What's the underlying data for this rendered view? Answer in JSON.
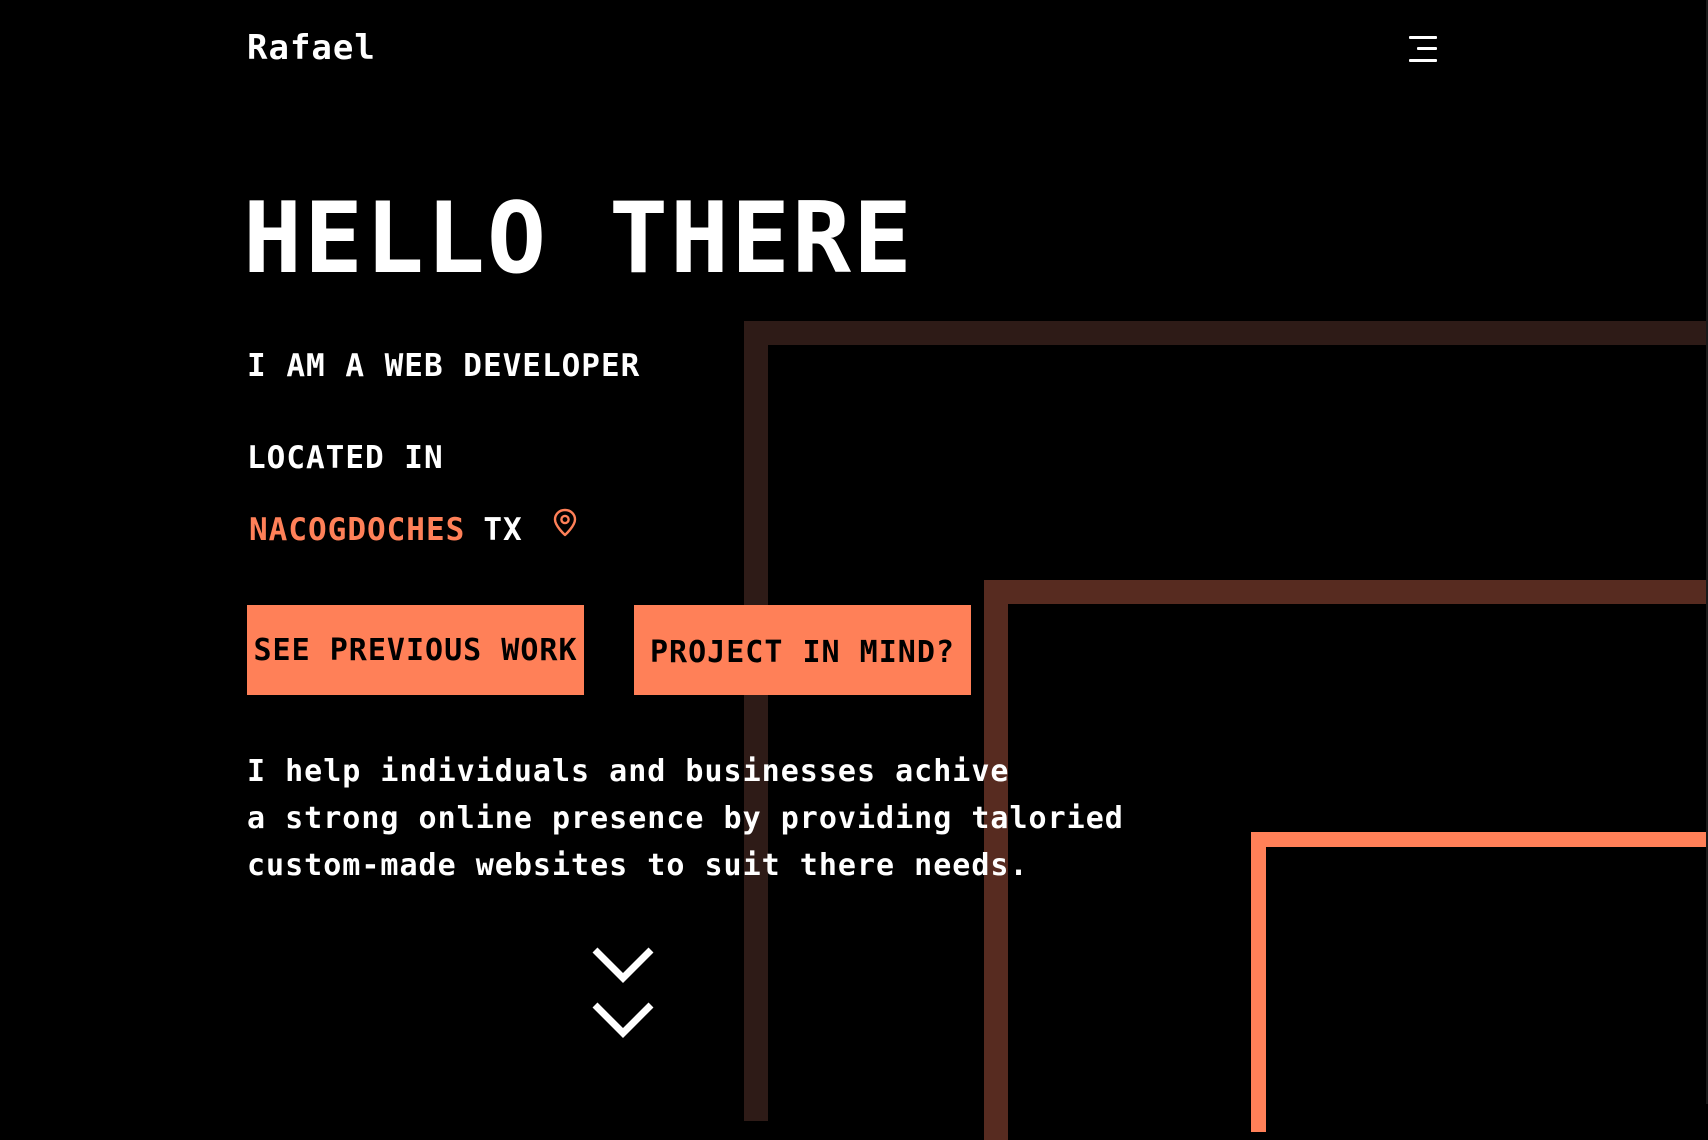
{
  "header": {
    "logo": "Rafael",
    "menu_icon": "hamburger-menu-icon"
  },
  "hero": {
    "title": "HELLO THERE",
    "role": "I AM A WEB DEVELOPER",
    "located_label": "LOCATED IN",
    "city": "NACOGDOCHES",
    "state": "TX",
    "location_icon": "map-pin-icon"
  },
  "buttons": {
    "previous_work": "SEE PREVIOUS WORK",
    "project": "PROJECT IN MIND?"
  },
  "description": {
    "lines": [
      "I help individuals and businesses achive",
      "a strong online presence by providing taloried",
      "custom-made websites to suit there needs."
    ]
  },
  "scroll": {
    "icon": "double-chevron-down-icon"
  },
  "colors": {
    "background": "#000000",
    "accent": "#ff8058",
    "frame_dark": "#2e1b17",
    "frame_mid": "#572b20",
    "text": "#ffffff"
  }
}
